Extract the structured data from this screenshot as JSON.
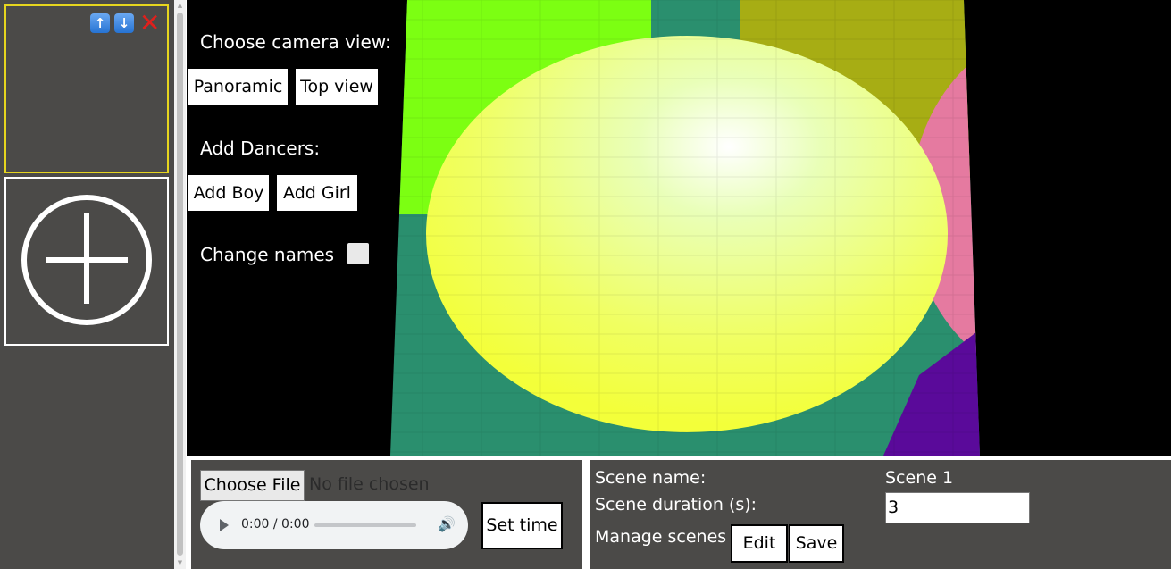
{
  "sidebar": {
    "scenes": [
      {
        "controls": {
          "up_icon": "arrow-up-icon",
          "up_glyph": "↑",
          "down_icon": "arrow-down-icon",
          "down_glyph": "↓",
          "delete_icon": "close-icon",
          "delete_glyph": "✕"
        }
      }
    ],
    "add_scene_icon": "plus-circle-icon"
  },
  "stage": {
    "camera_label": "Choose camera view:",
    "camera_buttons": [
      "Panoramic",
      "Top view"
    ],
    "dancers_label": "Add Dancers:",
    "dancer_buttons": [
      "Add Boy",
      "Add Girl"
    ],
    "change_names_label": "Change names",
    "change_names_checked": false,
    "colors": {
      "spotlight": "#f3ff5a",
      "green": "#7cff12",
      "pink": "#e57aa0",
      "purple": "#5a0a9a",
      "teal": "#2a8f6e",
      "olive": "#a7ad14"
    }
  },
  "music": {
    "choose_file_label": "Choose File",
    "no_file_text": "No file chosen",
    "audio_time": "0:00 / 0:00",
    "set_time_label": "Set time"
  },
  "scene": {
    "name_label": "Scene name:",
    "name_value": "Scene 1",
    "duration_label": "Scene duration (s):",
    "duration_value": "3",
    "manage_label": "Manage scenes :",
    "edit_label": "Edit",
    "save_label": "Save"
  }
}
